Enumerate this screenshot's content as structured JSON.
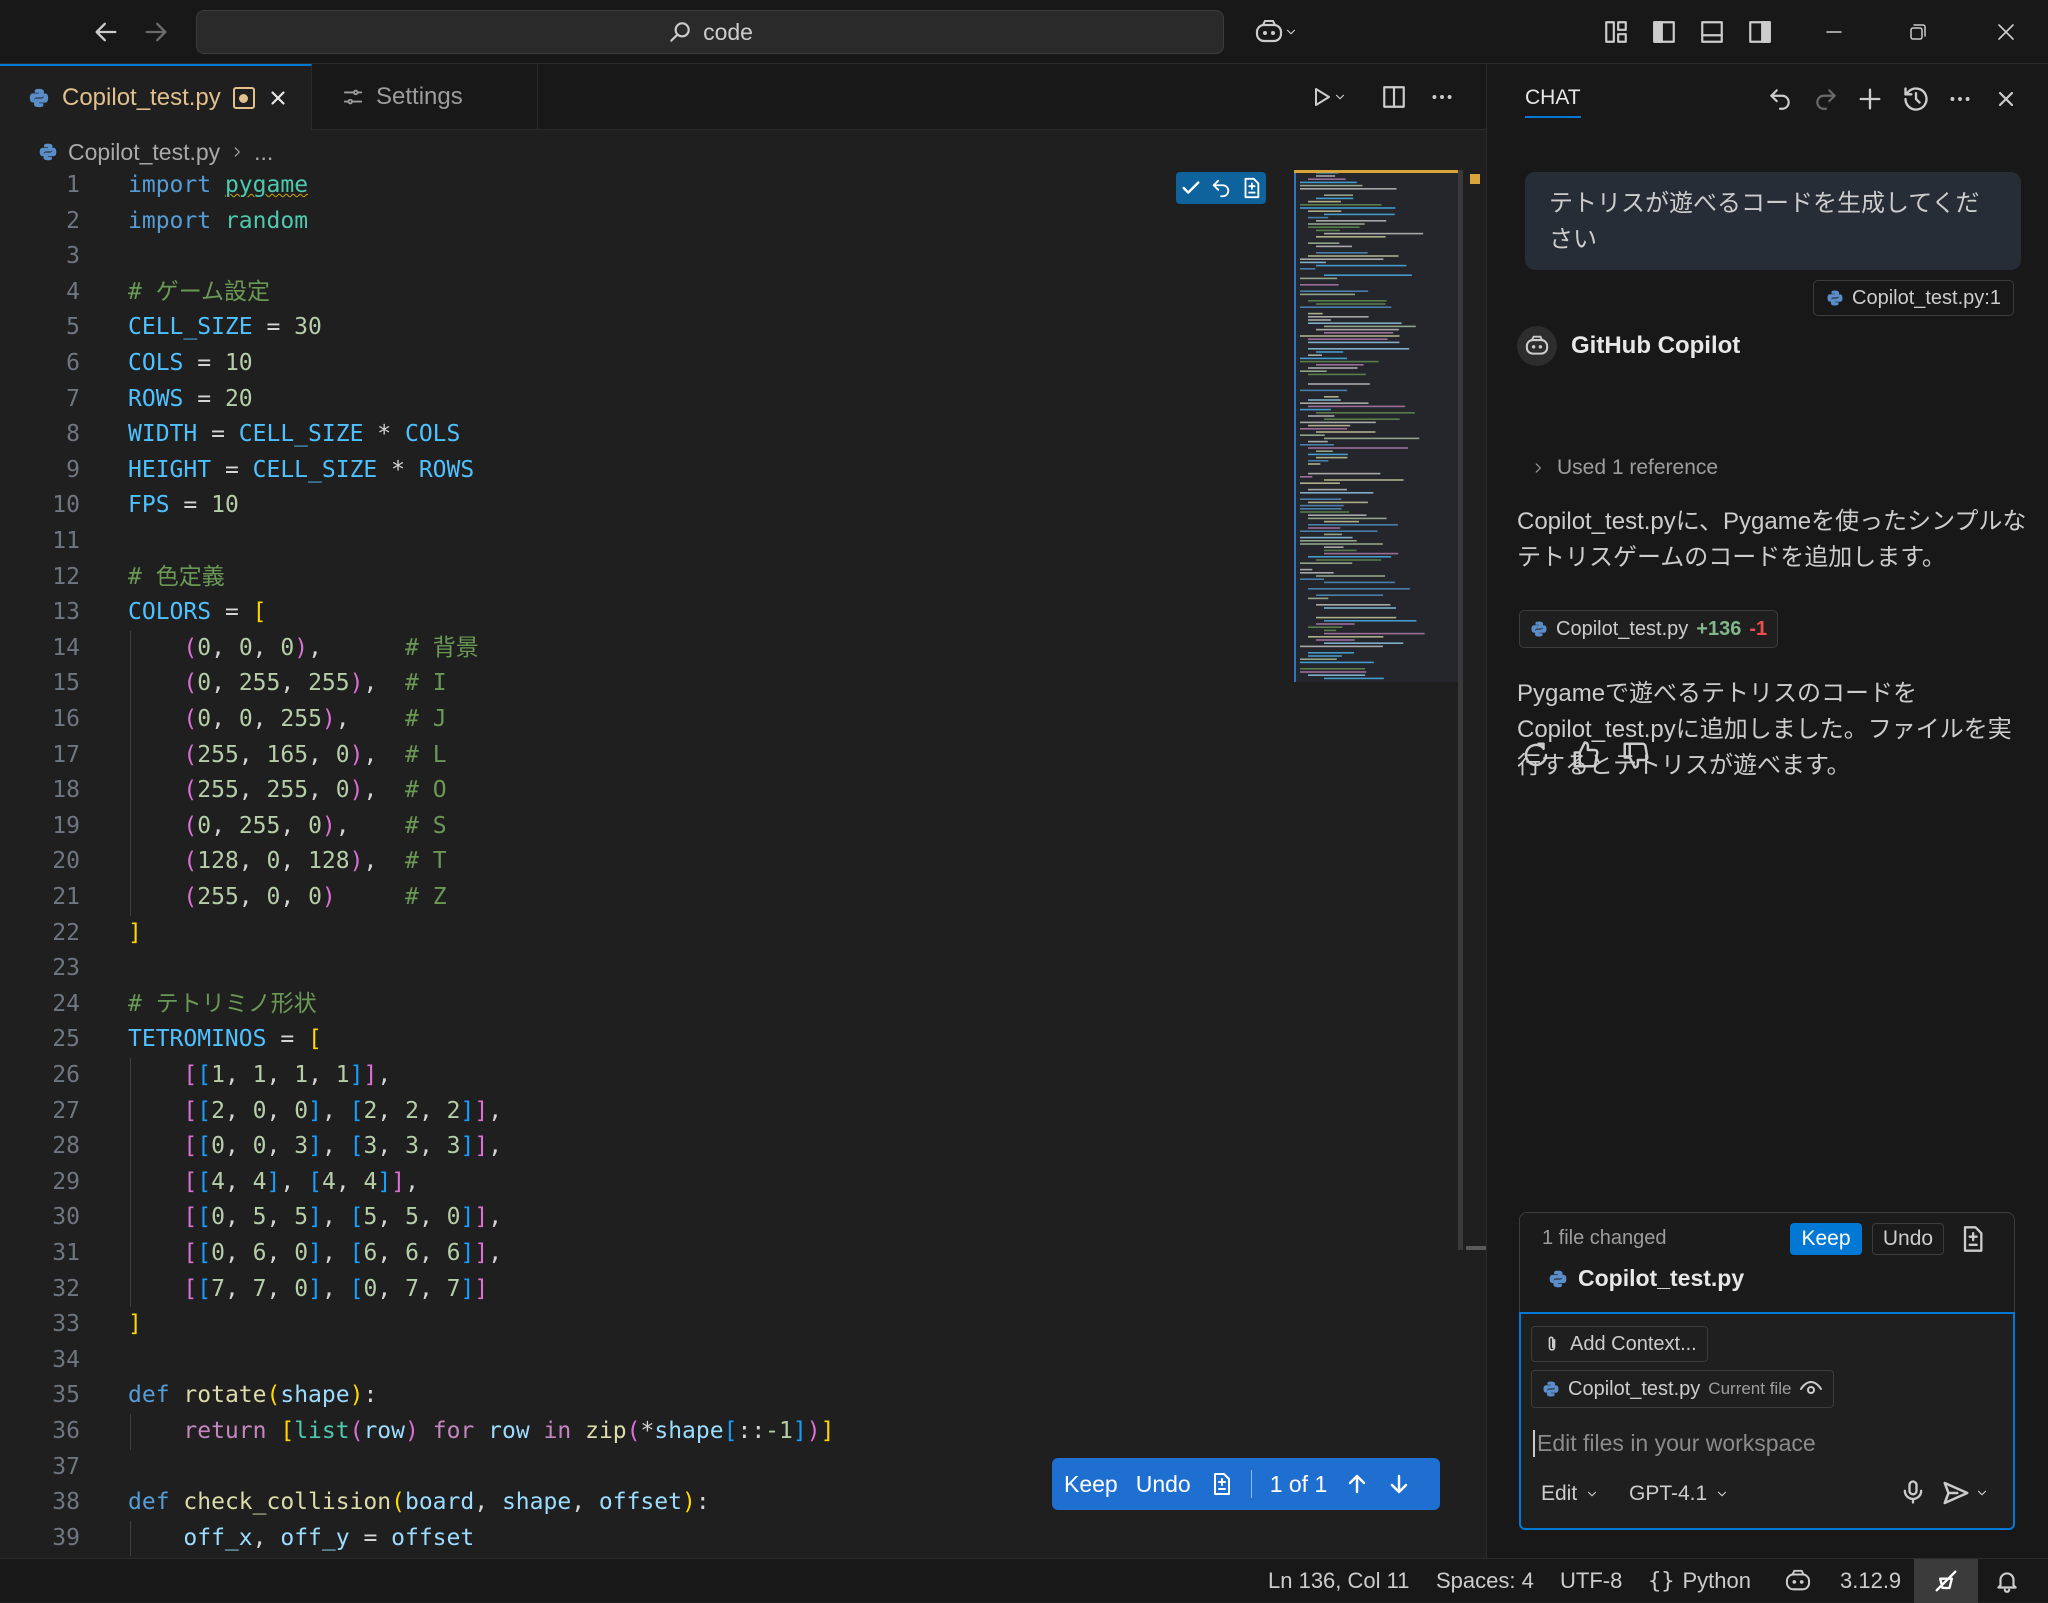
{
  "titlebar": {
    "search_text": "code"
  },
  "tabs": [
    {
      "label": "Copilot_test.py"
    },
    {
      "label": "Settings"
    }
  ],
  "breadcrumb": {
    "file": "Copilot_test.py",
    "rest": "..."
  },
  "editor": {
    "lines": [
      {
        "n": "1",
        "html": "<span class='kw'>import</span> <span class='mod squig'>pygame</span>"
      },
      {
        "n": "2",
        "html": "<span class='kw'>import</span> <span class='mod'>random</span>"
      },
      {
        "n": "3",
        "html": ""
      },
      {
        "n": "4",
        "html": "<span class='cmt'># ゲーム設定</span>"
      },
      {
        "n": "5",
        "html": "<span class='const'>CELL_SIZE</span> = <span class='num'>30</span>"
      },
      {
        "n": "6",
        "html": "<span class='const'>COLS</span> = <span class='num'>10</span>"
      },
      {
        "n": "7",
        "html": "<span class='const'>ROWS</span> = <span class='num'>20</span>"
      },
      {
        "n": "8",
        "html": "<span class='const'>WIDTH</span> = <span class='const'>CELL_SIZE</span> * <span class='const'>COLS</span>"
      },
      {
        "n": "9",
        "html": "<span class='const'>HEIGHT</span> = <span class='const'>CELL_SIZE</span> * <span class='const'>ROWS</span>"
      },
      {
        "n": "10",
        "html": "<span class='const'>FPS</span> = <span class='num'>10</span>"
      },
      {
        "n": "11",
        "html": ""
      },
      {
        "n": "12",
        "html": "<span class='cmt'># 色定義</span>"
      },
      {
        "n": "13",
        "html": "<span class='const'>COLORS</span> = <span class='b1'>[</span>"
      },
      {
        "n": "14",
        "html": "    <span class='b2'>(</span><span class='num'>0</span>, <span class='num'>0</span>, <span class='num'>0</span><span class='b2'>)</span>,      <span class='cmt'># 背景</span>"
      },
      {
        "n": "15",
        "html": "    <span class='b2'>(</span><span class='num'>0</span>, <span class='num'>255</span>, <span class='num'>255</span><span class='b2'>)</span>,  <span class='cmt'># I</span>"
      },
      {
        "n": "16",
        "html": "    <span class='b2'>(</span><span class='num'>0</span>, <span class='num'>0</span>, <span class='num'>255</span><span class='b2'>)</span>,    <span class='cmt'># J</span>"
      },
      {
        "n": "17",
        "html": "    <span class='b2'>(</span><span class='num'>255</span>, <span class='num'>165</span>, <span class='num'>0</span><span class='b2'>)</span>,  <span class='cmt'># L</span>"
      },
      {
        "n": "18",
        "html": "    <span class='b2'>(</span><span class='num'>255</span>, <span class='num'>255</span>, <span class='num'>0</span><span class='b2'>)</span>,  <span class='cmt'># O</span>"
      },
      {
        "n": "19",
        "html": "    <span class='b2'>(</span><span class='num'>0</span>, <span class='num'>255</span>, <span class='num'>0</span><span class='b2'>)</span>,    <span class='cmt'># S</span>"
      },
      {
        "n": "20",
        "html": "    <span class='b2'>(</span><span class='num'>128</span>, <span class='num'>0</span>, <span class='num'>128</span><span class='b2'>)</span>,  <span class='cmt'># T</span>"
      },
      {
        "n": "21",
        "html": "    <span class='b2'>(</span><span class='num'>255</span>, <span class='num'>0</span>, <span class='num'>0</span><span class='b2'>)</span>     <span class='cmt'># Z</span>"
      },
      {
        "n": "22",
        "html": "<span class='b1'>]</span>"
      },
      {
        "n": "23",
        "html": ""
      },
      {
        "n": "24",
        "html": "<span class='cmt'># テトリミノ形状</span>"
      },
      {
        "n": "25",
        "html": "<span class='const'>TETROMINOS</span> = <span class='b1'>[</span>"
      },
      {
        "n": "26",
        "html": "    <span class='b2'>[</span><span class='b3'>[</span><span class='num'>1</span>, <span class='num'>1</span>, <span class='num'>1</span>, <span class='num'>1</span><span class='b3'>]</span><span class='b2'>]</span>,"
      },
      {
        "n": "27",
        "html": "    <span class='b2'>[</span><span class='b3'>[</span><span class='num'>2</span>, <span class='num'>0</span>, <span class='num'>0</span><span class='b3'>]</span>, <span class='b3'>[</span><span class='num'>2</span>, <span class='num'>2</span>, <span class='num'>2</span><span class='b3'>]</span><span class='b2'>]</span>,"
      },
      {
        "n": "28",
        "html": "    <span class='b2'>[</span><span class='b3'>[</span><span class='num'>0</span>, <span class='num'>0</span>, <span class='num'>3</span><span class='b3'>]</span>, <span class='b3'>[</span><span class='num'>3</span>, <span class='num'>3</span>, <span class='num'>3</span><span class='b3'>]</span><span class='b2'>]</span>,"
      },
      {
        "n": "29",
        "html": "    <span class='b2'>[</span><span class='b3'>[</span><span class='num'>4</span>, <span class='num'>4</span><span class='b3'>]</span>, <span class='b3'>[</span><span class='num'>4</span>, <span class='num'>4</span><span class='b3'>]</span><span class='b2'>]</span>,"
      },
      {
        "n": "30",
        "html": "    <span class='b2'>[</span><span class='b3'>[</span><span class='num'>0</span>, <span class='num'>5</span>, <span class='num'>5</span><span class='b3'>]</span>, <span class='b3'>[</span><span class='num'>5</span>, <span class='num'>5</span>, <span class='num'>0</span><span class='b3'>]</span><span class='b2'>]</span>,"
      },
      {
        "n": "31",
        "html": "    <span class='b2'>[</span><span class='b3'>[</span><span class='num'>0</span>, <span class='num'>6</span>, <span class='num'>0</span><span class='b3'>]</span>, <span class='b3'>[</span><span class='num'>6</span>, <span class='num'>6</span>, <span class='num'>6</span><span class='b3'>]</span><span class='b2'>]</span>,"
      },
      {
        "n": "32",
        "html": "    <span class='b2'>[</span><span class='b3'>[</span><span class='num'>7</span>, <span class='num'>7</span>, <span class='num'>0</span><span class='b3'>]</span>, <span class='b3'>[</span><span class='num'>0</span>, <span class='num'>7</span>, <span class='num'>7</span><span class='b3'>]</span><span class='b2'>]</span>"
      },
      {
        "n": "33",
        "html": "<span class='b1'>]</span>"
      },
      {
        "n": "34",
        "html": ""
      },
      {
        "n": "35",
        "html": "<span class='kw'>def</span> <span class='fn'>rotate</span><span class='b1'>(</span><span class='var'>shape</span><span class='b1'>)</span>:"
      },
      {
        "n": "36",
        "html": "    <span class='kw2'>return</span> <span class='b1'>[</span><span class='mod'>list</span><span class='b2'>(</span><span class='var'>row</span><span class='b2'>)</span> <span class='kw2'>for</span> <span class='var'>row</span> <span class='kw2'>in</span> <span class='fn'>zip</span><span class='b2'>(</span>*<span class='var'>shape</span><span class='b3'>[</span>::<span class='num'>-1</span><span class='b3'>]</span><span class='b2'>)</span><span class='b1'>]</span>"
      },
      {
        "n": "37",
        "html": ""
      },
      {
        "n": "38",
        "html": "<span class='kw'>def</span> <span class='fn'>check_collision</span><span class='b1'>(</span><span class='var'>board</span>, <span class='var'>shape</span>, <span class='var'>offset</span><span class='b1'>)</span>:"
      },
      {
        "n": "39",
        "html": "    <span class='var'>off_x</span>, <span class='var'>off_y</span> = <span class='var'>offset</span>"
      }
    ]
  },
  "review_bar": {
    "keep": "Keep",
    "undo": "Undo",
    "position": "1 of 1"
  },
  "chat": {
    "title": "CHAT",
    "user_message": "テトリスが遊べるコードを生成してください",
    "ref_chip": "Copilot_test.py:1",
    "assistant_name": "GitHub Copilot",
    "used_reference": "Used 1 reference",
    "para1": "Copilot_test.pyに、Pygameを使ったシンプルなテトリスゲームのコードを追加します。",
    "change_file": "Copilot_test.py",
    "change_add": "+136",
    "change_del": "-1",
    "para2": "Pygameで遊べるテトリスのコードをCopilot_test.pyに追加しました。ファイルを実行するとテトリスが遊べます。",
    "files_changed": "1 file changed",
    "keep": "Keep",
    "undo": "Undo",
    "changed_file": "Copilot_test.py",
    "add_context": "Add Context...",
    "current_file_name": "Copilot_test.py",
    "current_file_tag": "Current file",
    "input_placeholder": "Edit files in your workspace",
    "mode": "Edit",
    "model": "GPT-4.1"
  },
  "statusbar": {
    "position": "Ln 136, Col 11",
    "spaces": "Spaces: 4",
    "encoding": "UTF-8",
    "language": "Python",
    "python_version": "3.12.9"
  },
  "colors": {
    "accent": "#0078d4",
    "modified": "#e2c08d"
  }
}
